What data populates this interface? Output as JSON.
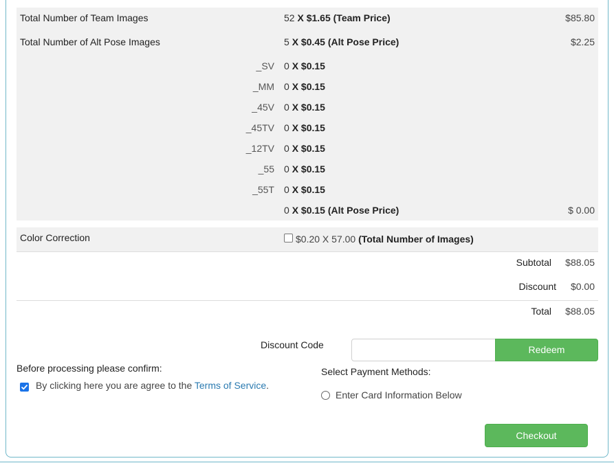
{
  "order": {
    "team": {
      "label": "Total Number of Team Images",
      "count": "52",
      "x": "X",
      "price": "$1.65",
      "price_note": "(Team Price)",
      "amount": "$85.80"
    },
    "alt": {
      "label": "Total Number of Alt Pose Images",
      "count": "5",
      "x": "X",
      "price": "$0.45",
      "price_note": "(Alt Pose Price)",
      "amount": "$2.25"
    },
    "poses": [
      {
        "suffix": "_SV",
        "count": "0",
        "x": "X",
        "price": "$0.15"
      },
      {
        "suffix": "_MM",
        "count": "0",
        "x": "X",
        "price": "$0.15"
      },
      {
        "suffix": "_45V",
        "count": "0",
        "x": "X",
        "price": "$0.15"
      },
      {
        "suffix": "_45TV",
        "count": "0",
        "x": "X",
        "price": "$0.15"
      },
      {
        "suffix": "_12TV",
        "count": "0",
        "x": "X",
        "price": "$0.15"
      },
      {
        "suffix": "_55",
        "count": "0",
        "x": "X",
        "price": "$0.15"
      },
      {
        "suffix": "_55T",
        "count": "0",
        "x": "X",
        "price": "$0.15"
      }
    ],
    "alt_total": {
      "count": "0",
      "x": "X",
      "price": "$0.15",
      "price_note": "(Alt Pose Price)",
      "amount": "$ 0.00"
    },
    "color_correction": {
      "label": "Color Correction",
      "checked": false,
      "detail": "$0.20 X 57.00",
      "detail_note": "(Total Number of Images)"
    }
  },
  "summary": {
    "subtotal_label": "Subtotal",
    "subtotal": "$88.05",
    "discount_label": "Discount",
    "discount": "$0.00",
    "total_label": "Total",
    "total": "$88.05"
  },
  "discount_code": {
    "label": "Discount Code",
    "value": "",
    "placeholder": "",
    "redeem_label": "Redeem"
  },
  "confirm": {
    "title": "Before processing please confirm:",
    "checked": true,
    "text": "By clicking here you are agree to the",
    "link": "Terms of Service",
    "period": "."
  },
  "payment": {
    "title": "Select Payment Methods:",
    "option": "Enter Card Information Below",
    "selected": false
  },
  "checkout_label": "Checkout",
  "colors": {
    "accent_green": "#5cb85c",
    "link_blue": "#2a7ab0",
    "panel_border": "#6fb7c9",
    "row_gray": "#f1f1f1"
  }
}
